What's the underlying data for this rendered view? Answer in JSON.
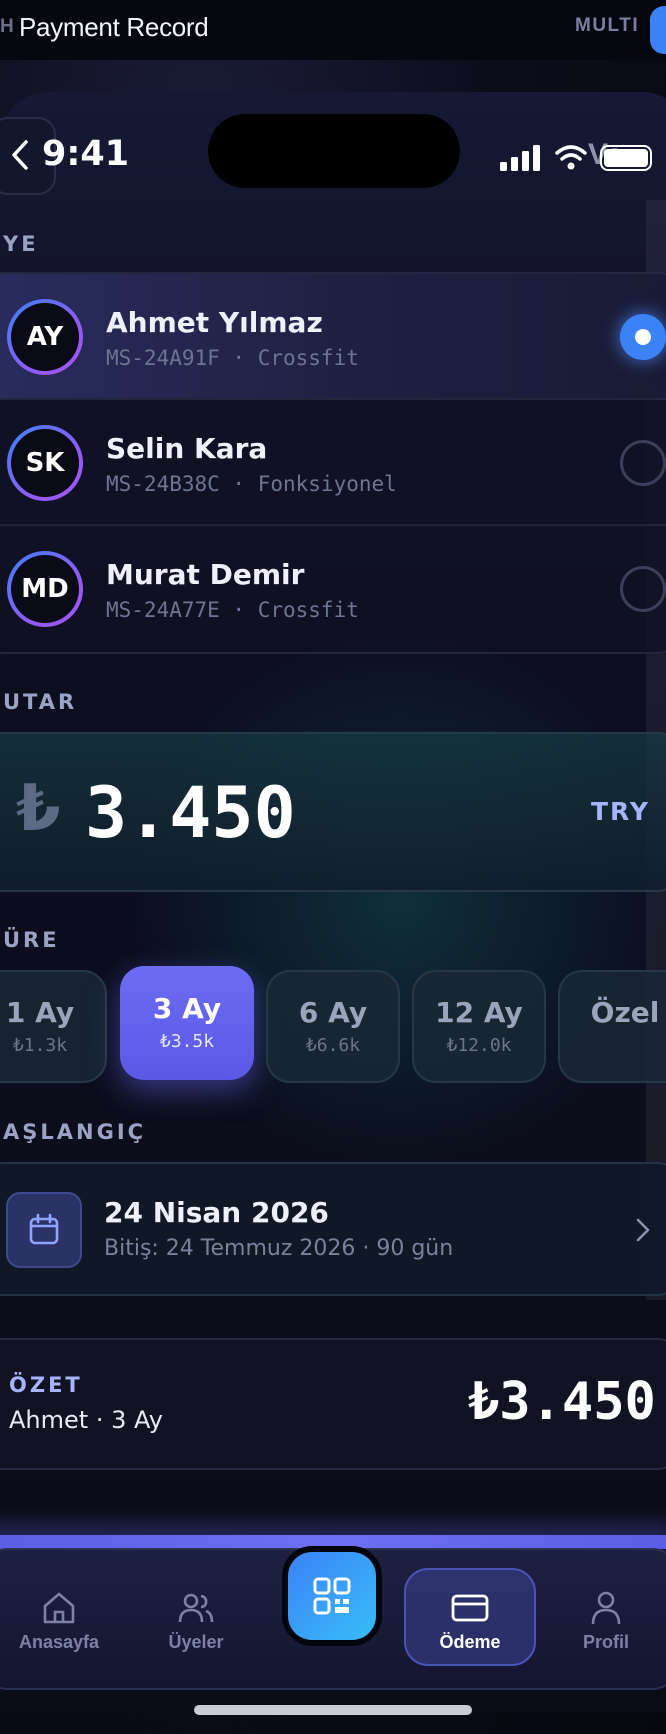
{
  "top_bar": {
    "left_fragment": "H",
    "title": "Payment Record",
    "right_fragment": "MULTI"
  },
  "status_bar": {
    "time": "9:41",
    "carrier_fragment": "Ve"
  },
  "members_section": {
    "label": "YE",
    "members": [
      {
        "initials": "AY",
        "name": "Ahmet Yılmaz",
        "subtitle": "MS-24A91F · Crossfit",
        "selected": true
      },
      {
        "initials": "SK",
        "name": "Selin Kara",
        "subtitle": "MS-24B38C · Fonksiyonel",
        "selected": false
      },
      {
        "initials": "MD",
        "name": "Murat Demir",
        "subtitle": "MS-24A77E · Crossfit",
        "selected": false
      }
    ]
  },
  "amount_section": {
    "label": "UTAR",
    "currency_symbol": "₺",
    "amount": "3.450",
    "currency_code": "TRY"
  },
  "duration_section": {
    "label": "ÜRE",
    "options": [
      {
        "label": "1 Ay",
        "price": "₺1.3k",
        "active": false
      },
      {
        "label": "3 Ay",
        "price": "₺3.5k",
        "active": true
      },
      {
        "label": "6 Ay",
        "price": "₺6.6k",
        "active": false
      },
      {
        "label": "12 Ay",
        "price": "₺12.0k",
        "active": false
      },
      {
        "label": "Özel",
        "price": "",
        "active": false
      }
    ]
  },
  "start_section": {
    "label": "AŞLANGIÇ",
    "date": "24 Nisan 2026",
    "end_text": "Bitiş: 24 Temmuz 2026 · 90 gün"
  },
  "summary": {
    "label": "ÖZET",
    "description": "Ahmet · 3 Ay",
    "total": "₺3.450"
  },
  "tab_bar": {
    "tabs": [
      {
        "label": "Anasayfa",
        "icon": "home-icon"
      },
      {
        "label": "Üyeler",
        "icon": "users-icon"
      },
      {
        "label": "Ödeme",
        "icon": "card-icon",
        "active": true
      },
      {
        "label": "Profil",
        "icon": "person-icon"
      }
    ],
    "center_action_icon": "qr-code-icon"
  },
  "colors": {
    "accent": "#6366f1",
    "accent_blue": "#3b82f6",
    "amount_teal": "#16585e",
    "background": "#0a0c17"
  }
}
